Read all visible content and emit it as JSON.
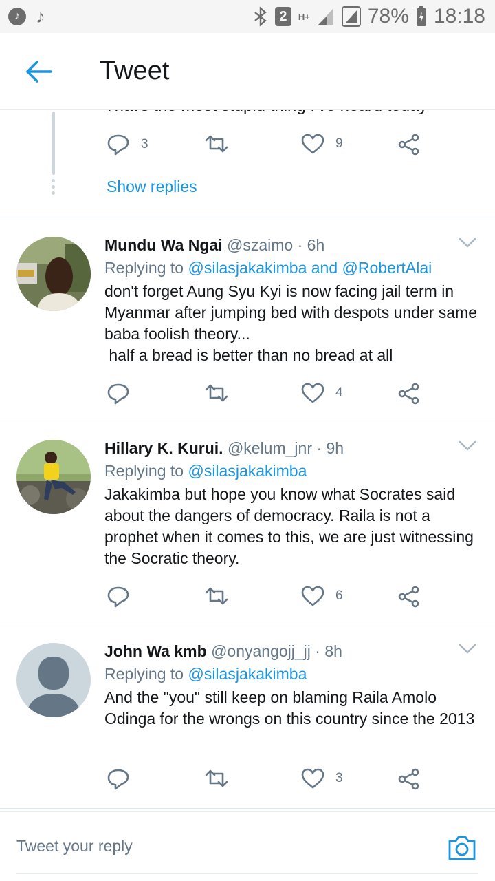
{
  "status_bar": {
    "sim_number": "2",
    "network_label": "H+",
    "battery": "78%",
    "time": "18:18"
  },
  "app_bar": {
    "title": "Tweet"
  },
  "partial_reply": {
    "text": "That's the most stupid thing I've heard today",
    "reply_count": "3",
    "like_count": "9",
    "show_replies_label": "Show replies"
  },
  "tweets": [
    {
      "name": "Mundu Wa Ngai",
      "handle": "@szaimo",
      "time": "6h",
      "replying_prefix": "Replying to",
      "mentions": "@silasjakakimba and @RobertAlai",
      "text": "don't forget Aung Syu Kyi is now facing jail term in Myanmar after jumping bed with despots under same baba foolish theory...\n half a bread is better than no bread at all",
      "reply_count": "",
      "retweet_count": "",
      "like_count": "4"
    },
    {
      "name": "Hillary K. Kurui.",
      "handle": "@kelum_jnr",
      "time": "9h",
      "replying_prefix": "Replying to",
      "mentions": "@silasjakakimba",
      "text": "Jakakimba but hope you know what Socrates said about the dangers of democracy. Raila is not a prophet when it comes to this, we are just witnessing the Socratic theory.",
      "reply_count": "",
      "retweet_count": "",
      "like_count": "6"
    },
    {
      "name": "John Wa kmb",
      "handle": "@onyangojj_jj",
      "time": "8h",
      "replying_prefix": "Replying to",
      "mentions": "@silasjakakimba",
      "text": "And the \"you\" still keep on blaming Raila Amolo Odinga for the wrongs on this country since the 2013",
      "reply_count": "",
      "retweet_count": "",
      "like_count": "3"
    }
  ],
  "compose": {
    "placeholder": "Tweet your reply"
  },
  "colors": {
    "accent": "#1b95e0",
    "secondary_text": "#657786",
    "divider": "#e1e8ed"
  },
  "icons": [
    "music-icon",
    "bluetooth-icon",
    "signal-icon",
    "battery-icon",
    "back-arrow-icon",
    "reply-icon",
    "retweet-icon",
    "like-icon",
    "share-icon",
    "chevron-down-icon",
    "camera-icon"
  ]
}
